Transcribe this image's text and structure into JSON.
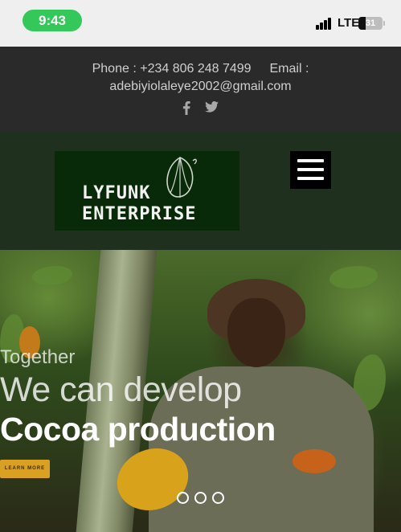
{
  "status_bar": {
    "time": "9:43",
    "network": "LTE",
    "battery": "31",
    "battery_level": 0.31
  },
  "contact": {
    "phone_label": "Phone :",
    "phone": "+234 806 248 7499",
    "email_label": "Email :",
    "email": "adebiyiolaleye2002@gmail.com",
    "social_icons": [
      "facebook-icon",
      "twitter-icon"
    ]
  },
  "header": {
    "logo_line1": "LYFUNK",
    "logo_line2": "ENTERPRISE",
    "menu_icon": "hamburger-menu-icon"
  },
  "hero": {
    "line1": "Together",
    "line2": "We can develop",
    "line3": "Cocoa production",
    "cta": "LEARN MORE",
    "slides": 3
  },
  "colors": {
    "status_green": "#34c759",
    "topbar_bg": "#2a2a2a",
    "header_bg": "#20301f",
    "logo_bg": "#082a08",
    "cta_gold": "#d9a021"
  }
}
